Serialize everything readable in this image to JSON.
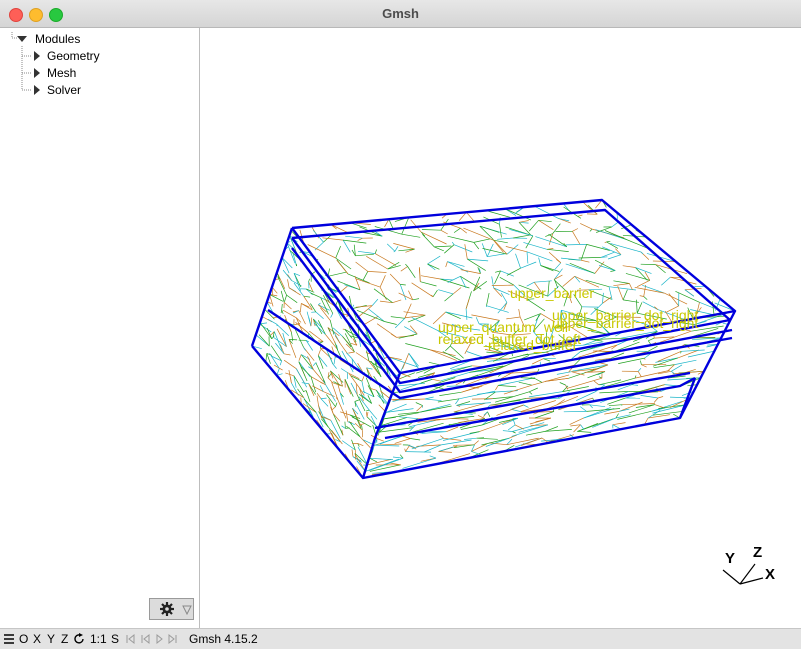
{
  "window": {
    "title": "Gmsh"
  },
  "tree": {
    "root": "Modules",
    "items": [
      {
        "label": "Geometry"
      },
      {
        "label": "Mesh"
      },
      {
        "label": "Solver"
      }
    ]
  },
  "viewport": {
    "labels": [
      "upper_barrier",
      "upper_barrier_dot_right",
      "upper_barrier_dot_right",
      "upper_quantum_well",
      "relaxed_buffer_dot_left",
      "relaxed_buffer"
    ],
    "axes": {
      "x": "X",
      "y": "Y",
      "z": "Z"
    },
    "colors": {
      "edges": "#0000dd",
      "mesh_a": "#1fa01f",
      "mesh_b": "#c8781e",
      "mesh_c": "#19b4c8",
      "label": "#c8c800"
    }
  },
  "statusbar": {
    "menu_icon": "hamburger-icon",
    "o": "O",
    "x": "X",
    "y": "Y",
    "z": "Z",
    "rotate_icon": "rotate-icon",
    "scale": "1:1",
    "s": "S",
    "version": "Gmsh 4.15.2"
  }
}
